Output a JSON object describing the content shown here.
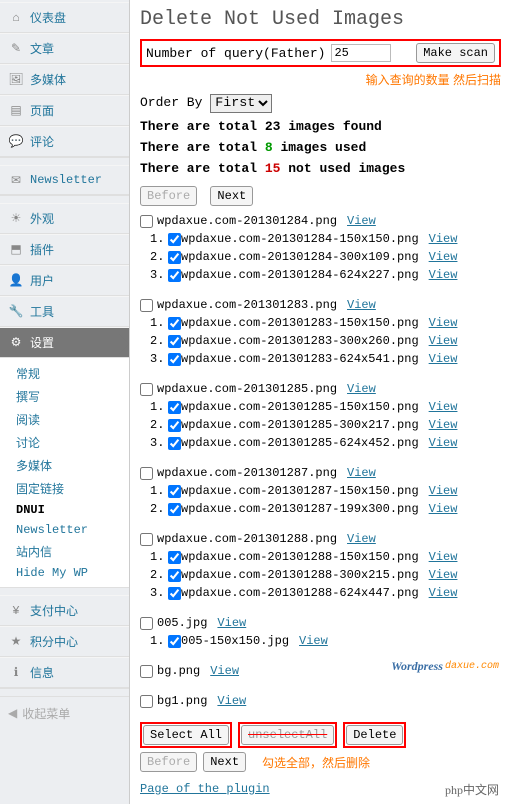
{
  "sidebar": {
    "items": [
      {
        "label": "仪表盘",
        "icon": "dash"
      },
      {
        "label": "文章",
        "icon": "pin"
      },
      {
        "label": "多媒体",
        "icon": "media"
      },
      {
        "label": "页面",
        "icon": "page"
      },
      {
        "label": "评论",
        "icon": "comment"
      },
      {
        "label": "Newsletter",
        "icon": "mail"
      },
      {
        "label": "外观",
        "icon": "appearance"
      },
      {
        "label": "插件",
        "icon": "plugin"
      },
      {
        "label": "用户",
        "icon": "users"
      },
      {
        "label": "工具",
        "icon": "tools"
      },
      {
        "label": "设置",
        "icon": "settings"
      }
    ],
    "sub": [
      "常规",
      "撰写",
      "阅读",
      "讨论",
      "多媒体",
      "固定链接",
      "DNUI",
      "Newsletter",
      "站内信",
      "Hide My WP"
    ],
    "sub_current": "DNUI",
    "items2": [
      {
        "label": "支付中心",
        "icon": "pay"
      },
      {
        "label": "积分中心",
        "icon": "point"
      },
      {
        "label": "信息",
        "icon": "info"
      }
    ],
    "collapse": "收起菜单"
  },
  "page": {
    "title": "Delete Not Used Images",
    "query_label": "Number of query(Father)",
    "query_value": "25",
    "scan_btn": "Make scan",
    "annot_top": "输入查询的数量 然后扫描",
    "order_label": "Order By",
    "order_value": "First",
    "stat_found_pre": "There are total ",
    "stat_found_n": "23",
    "stat_found_post": " images found",
    "stat_used_pre": "There are total ",
    "stat_used_n": "8",
    "stat_used_post": " images used",
    "stat_notused_pre": "There are total ",
    "stat_notused_n": "15",
    "stat_notused_post": " not used images",
    "before": "Before",
    "next": "Next",
    "view": "View",
    "select_all": "Select All",
    "unselect_all": "unselectAll",
    "delete": "Delete",
    "annot_bottom": "勾选全部，然后删除",
    "page_plugin": "Page of the plugin",
    "watermark1": "Wordpress",
    "watermark1b": "daxue.com",
    "watermark2": "php中文网"
  },
  "files": [
    {
      "name": "wpdaxue.com-201301284.png",
      "chk": false,
      "subs": [
        {
          "name": "wpdaxue.com-201301284-150x150.png"
        },
        {
          "name": "wpdaxue.com-201301284-300x109.png"
        },
        {
          "name": "wpdaxue.com-201301284-624x227.png"
        }
      ]
    },
    {
      "name": "wpdaxue.com-201301283.png",
      "chk": false,
      "subs": [
        {
          "name": "wpdaxue.com-201301283-150x150.png"
        },
        {
          "name": "wpdaxue.com-201301283-300x260.png"
        },
        {
          "name": "wpdaxue.com-201301283-624x541.png"
        }
      ]
    },
    {
      "name": "wpdaxue.com-201301285.png",
      "chk": false,
      "subs": [
        {
          "name": "wpdaxue.com-201301285-150x150.png"
        },
        {
          "name": "wpdaxue.com-201301285-300x217.png"
        },
        {
          "name": "wpdaxue.com-201301285-624x452.png"
        }
      ]
    },
    {
      "name": "wpdaxue.com-201301287.png",
      "chk": false,
      "subs": [
        {
          "name": "wpdaxue.com-201301287-150x150.png"
        },
        {
          "name": "wpdaxue.com-201301287-199x300.png"
        }
      ]
    },
    {
      "name": "wpdaxue.com-201301288.png",
      "chk": false,
      "subs": [
        {
          "name": "wpdaxue.com-201301288-150x150.png"
        },
        {
          "name": "wpdaxue.com-201301288-300x215.png"
        },
        {
          "name": "wpdaxue.com-201301288-624x447.png"
        }
      ]
    },
    {
      "name": "005.jpg",
      "chk": false,
      "subs": [
        {
          "name": "005-150x150.jpg"
        }
      ]
    },
    {
      "name": "bg.png",
      "chk": false,
      "subs": []
    },
    {
      "name": "bg1.png",
      "chk": false,
      "subs": []
    }
  ]
}
